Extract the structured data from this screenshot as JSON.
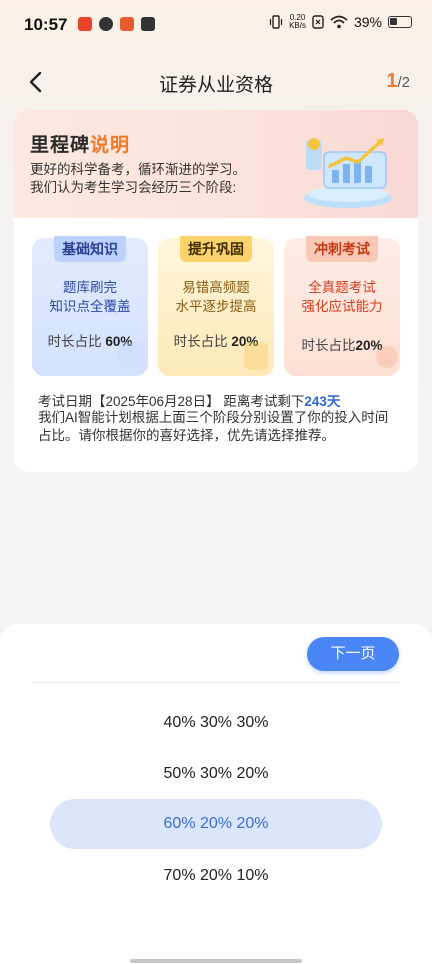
{
  "status_bar": {
    "time": "10:57",
    "net_speed_value": "0.20",
    "net_speed_unit": "KB/s",
    "battery": "39%"
  },
  "header": {
    "title": "证券从业资格",
    "page_current": "1",
    "page_total": "/2"
  },
  "milestone": {
    "title_part1": "里程碑",
    "title_part2": "说明",
    "desc_line1": "更好的科学备考，循环渐进的学习。",
    "desc_line2": "我们认为考生学习会经历三个阶段:"
  },
  "stages": [
    {
      "tag": "基础知识",
      "line1": "题库刷完",
      "line2": "知识点全覆盖",
      "ratio_label": "时长占比",
      "ratio_value": "60%"
    },
    {
      "tag": "提升巩固",
      "line1": "易错高频题",
      "line2": "水平逐步提高",
      "ratio_label": "时长占比",
      "ratio_value": "20%"
    },
    {
      "tag": "冲刺考试",
      "line1": "全真题考试",
      "line2": "强化应试能力",
      "ratio_label": "时长占比",
      "ratio_value": "20%"
    }
  ],
  "exam": {
    "date_text": "考试日期【2025年06月28日】",
    "remaining_label": "距离考试剩下",
    "remaining_days": "243天",
    "note": "我们AI智能计划根据上面三个阶段分别设置了你的投入时间占比。请你根据你的喜好选择，优先请选择推荐。"
  },
  "sheet": {
    "next_label": "下一页",
    "options": [
      "40% 30% 30%",
      "50% 30% 20%",
      "60% 20% 20%",
      "70% 20% 10%"
    ],
    "selected_index": 2
  },
  "colors": {
    "accent": "#4a86f5",
    "highlight_orange": "#f07a2a",
    "selected_bg": "#dbe6fb"
  }
}
